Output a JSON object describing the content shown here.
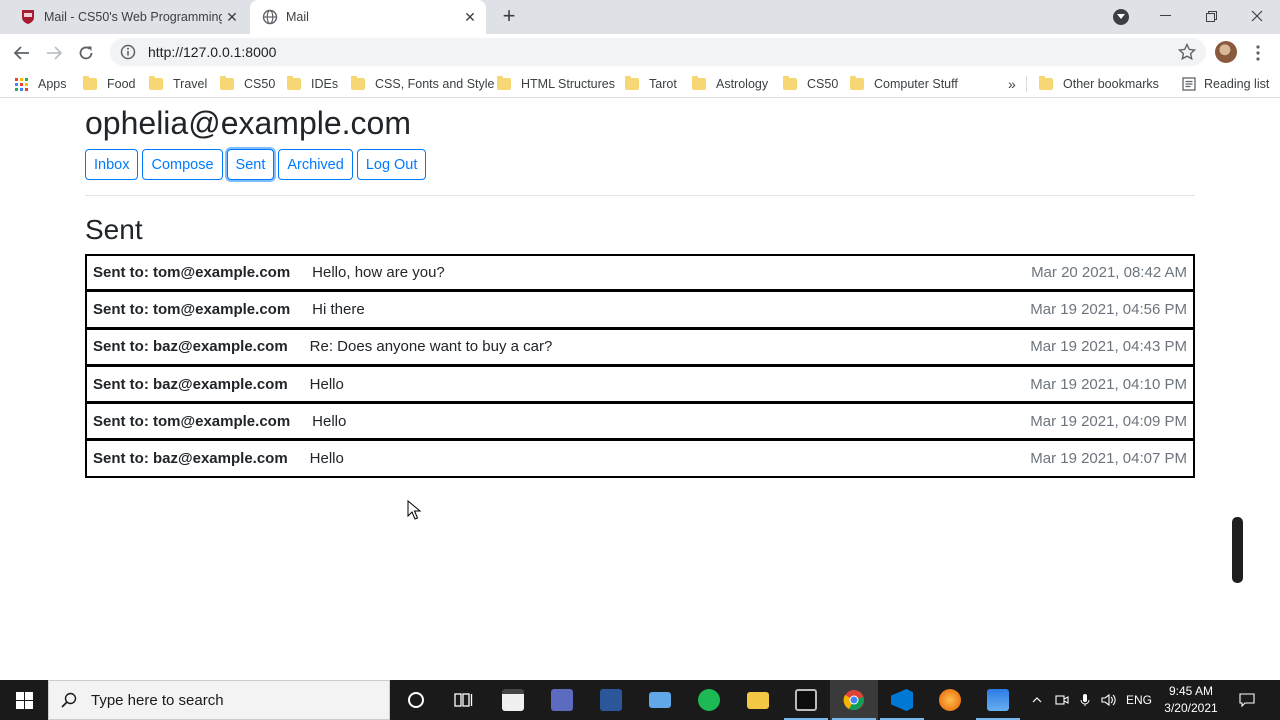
{
  "browser": {
    "tabs": [
      {
        "title": "Mail - CS50's Web Programming",
        "active": false
      },
      {
        "title": "Mail",
        "active": true
      }
    ],
    "url": "http://127.0.0.1:8000",
    "bookmarks": [
      {
        "label": "Apps",
        "icon": "apps-grid-icon"
      },
      {
        "label": "Food",
        "icon": "folder-icon"
      },
      {
        "label": "Travel",
        "icon": "folder-icon"
      },
      {
        "label": "CS50",
        "icon": "folder-icon"
      },
      {
        "label": "IDEs",
        "icon": "folder-icon"
      },
      {
        "label": "CSS, Fonts and Style",
        "icon": "folder-icon"
      },
      {
        "label": "HTML Structures",
        "icon": "folder-icon"
      },
      {
        "label": "Tarot",
        "icon": "folder-icon"
      },
      {
        "label": "Astrology",
        "icon": "folder-icon"
      },
      {
        "label": "CS50",
        "icon": "folder-icon"
      },
      {
        "label": "Computer Stuff",
        "icon": "folder-icon"
      }
    ],
    "bookmarks_overflow": "»",
    "other_bookmarks": "Other bookmarks",
    "reading_list": "Reading list"
  },
  "page": {
    "user_email": "ophelia@example.com",
    "nav_buttons": [
      {
        "label": "Inbox"
      },
      {
        "label": "Compose"
      },
      {
        "label": "Sent",
        "focused": true
      },
      {
        "label": "Archived"
      },
      {
        "label": "Log Out"
      }
    ],
    "section_title": "Sent",
    "emails": [
      {
        "recipient": "Sent to: tom@example.com",
        "subject": "Hello, how are you?",
        "timestamp": "Mar 20 2021, 08:42 AM"
      },
      {
        "recipient": "Sent to: tom@example.com",
        "subject": "Hi there",
        "timestamp": "Mar 19 2021, 04:56 PM"
      },
      {
        "recipient": "Sent to: baz@example.com",
        "subject": "Re: Does anyone want to buy a car?",
        "timestamp": "Mar 19 2021, 04:43 PM"
      },
      {
        "recipient": "Sent to: baz@example.com",
        "subject": "Hello",
        "timestamp": "Mar 19 2021, 04:10 PM"
      },
      {
        "recipient": "Sent to: tom@example.com",
        "subject": "Hello",
        "timestamp": "Mar 19 2021, 04:09 PM"
      },
      {
        "recipient": "Sent to: baz@example.com",
        "subject": "Hello",
        "timestamp": "Mar 19 2021, 04:07 PM"
      }
    ]
  },
  "taskbar": {
    "search_placeholder": "Type here to search",
    "language": "ENG",
    "time": "9:45 AM",
    "date": "3/20/2021",
    "icons": [
      "cortana-icon",
      "task-view-icon",
      "store-icon",
      "vs-icon",
      "word-icon",
      "explorer-pc-icon",
      "spotify-icon",
      "file-explorer-icon",
      "terminal-icon",
      "chrome-icon",
      "vscode-icon",
      "firefox-icon",
      "photos-icon"
    ]
  },
  "colors": {
    "primary": "#007bff",
    "muted": "#6c757d",
    "text": "#212529"
  }
}
